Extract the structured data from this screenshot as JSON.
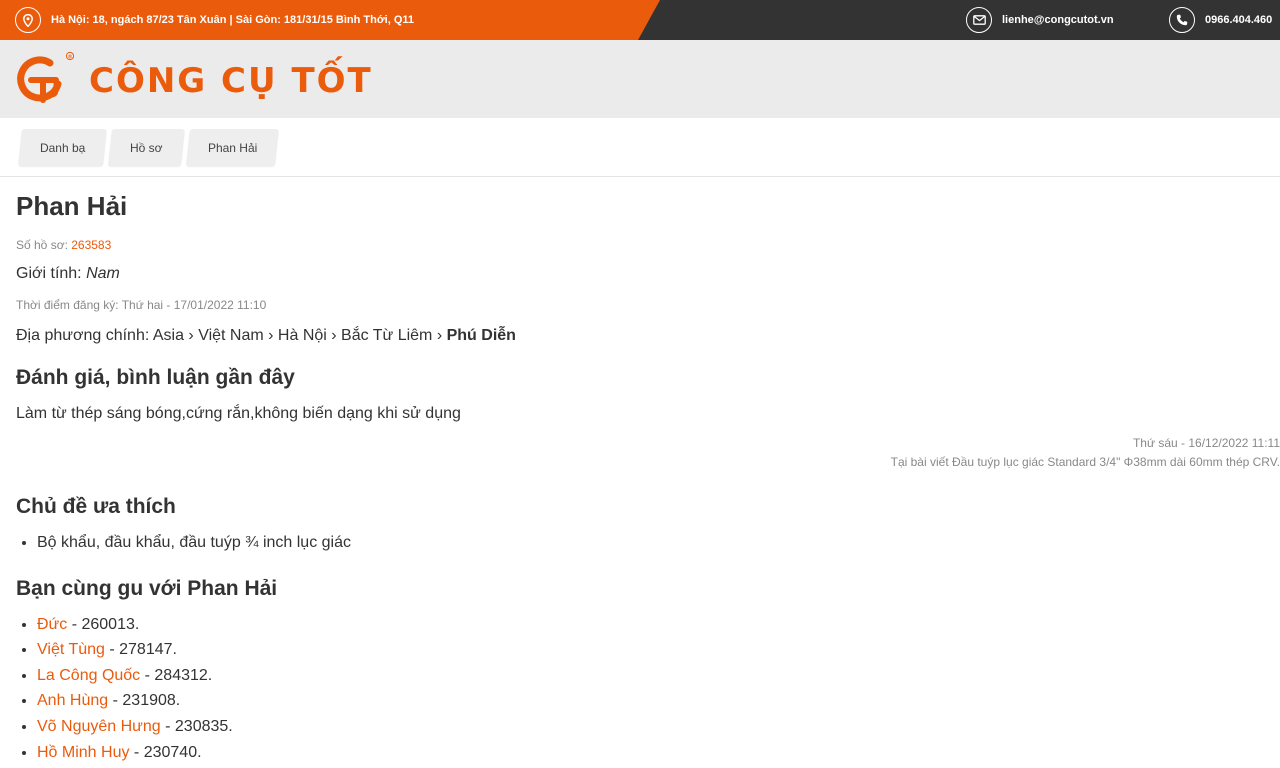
{
  "topbar": {
    "address": "Hà Nội: 18, ngách 87/23 Tân Xuân | Sài Gòn: 181/31/15 Bình Thới, Q11",
    "email": "lienhe@congcutot.vn",
    "phone": "0966.404.460",
    "icons": [
      "map-pin-icon",
      "envelope-icon",
      "phone-icon"
    ],
    "colors": {
      "accent": "#ea5b0c",
      "dark": "#333333"
    }
  },
  "header": {
    "logo_text": "CÔNG CỤ TỐT",
    "logo_registered": "®"
  },
  "breadcrumb": [
    "Danh bạ",
    "Hồ sơ",
    "Phan Hải"
  ],
  "profile": {
    "name": "Phan Hải",
    "profile_no_label": "Số hồ sơ: ",
    "profile_no": "263583",
    "gender_label": "Giới tính: ",
    "gender": "Nam",
    "registered": "Thời điểm đăng ký: Thứ hai - 17/01/2022 11:10",
    "location_label": "Địa phương chính: ",
    "location_path": "Asia › Việt Nam › Hà Nội › Bắc Từ Liêm › ",
    "location_last": "Phú Diễn"
  },
  "reviews": {
    "title": "Đánh giá, bình luận gần đây",
    "items": [
      {
        "text": "Làm từ thép sáng bóng,cứng rắn,không biến dạng khi sử dụng",
        "date": "Thứ sáu - 16/12/2022 11:11",
        "source": "Tại bài viết Đầu tuýp lục giác Standard 3/4\" Φ38mm dài 60mm thép CRV."
      }
    ]
  },
  "topics": {
    "title": "Chủ đề ưa thích",
    "items": [
      "Bộ khẩu, đầu khẩu, đầu tuýp ¾ inch lục giác"
    ]
  },
  "friends": {
    "title": "Bạn cùng gu với Phan Hải",
    "items": [
      {
        "name": "Đức",
        "id": " - 260013."
      },
      {
        "name": "Việt Tùng",
        "id": " - 278147."
      },
      {
        "name": "La Công Quốc",
        "id": " - 284312."
      },
      {
        "name": "Anh Hùng",
        "id": " - 231908."
      },
      {
        "name": "Võ Nguyên Hưng",
        "id": " - 230835."
      },
      {
        "name": "Hồ Minh Huy",
        "id": " - 230740."
      }
    ]
  }
}
